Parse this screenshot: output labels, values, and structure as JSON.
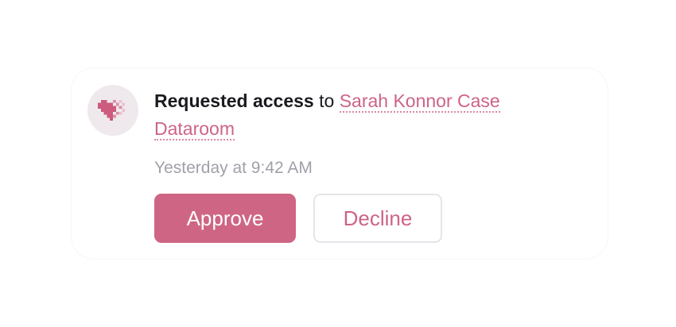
{
  "notification": {
    "avatar_icon": "pixel-heart-icon",
    "action_text": "Requested access",
    "connector_text": " to ",
    "target_link": "Sarah Konnor Case Dataroom",
    "timestamp": "Yesterday at 9:42 AM",
    "approve_label": "Approve",
    "decline_label": "Decline"
  },
  "colors": {
    "accent": "#cf6584",
    "link": "#cd6485",
    "avatar_bg": "#efe9ed",
    "muted_text": "#a0a0aa",
    "primary_text": "#1a1a1f"
  }
}
